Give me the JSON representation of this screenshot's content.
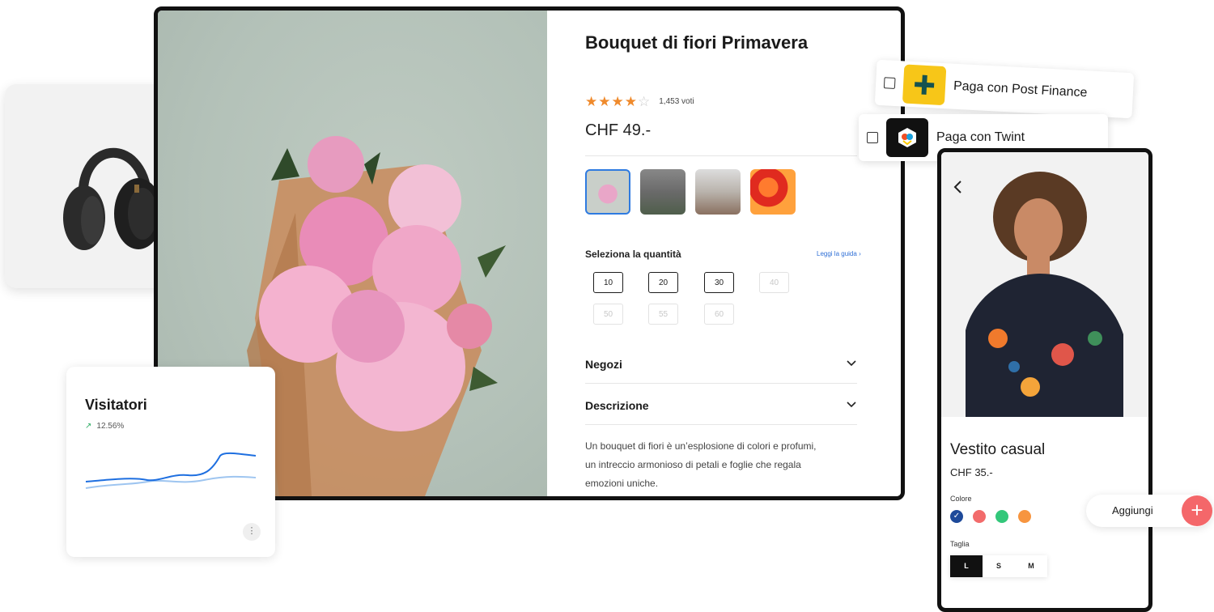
{
  "product": {
    "title": "Bouquet di fiori Primavera",
    "rating": 4,
    "rating_max": 5,
    "votes": "1,453 voti",
    "price": "CHF 49.-",
    "thumbnails": [
      "bouquet-peonies",
      "tulips-vase",
      "dried-flowers",
      "orange-red-roses"
    ],
    "quantity_label": "Seleziona la quantità",
    "guide_link": "Leggi la guida",
    "quantities": [
      {
        "value": "10",
        "enabled": true
      },
      {
        "value": "20",
        "enabled": true
      },
      {
        "value": "30",
        "enabled": true
      },
      {
        "value": "40",
        "enabled": false
      },
      {
        "value": "50",
        "enabled": false
      },
      {
        "value": "55",
        "enabled": false
      },
      {
        "value": "60",
        "enabled": false
      }
    ],
    "accordion": [
      "Negozi",
      "Descrizione"
    ],
    "description": "Un bouquet di fiori è un’esplosione di colori e profumi, un intreccio armonioso di petali e foglie che regala emozioni uniche."
  },
  "visitors": {
    "title": "Visitatori",
    "growth": "12.56%",
    "menu_icon": "more-vertical-icon"
  },
  "payments": [
    {
      "label": "Paga con Post Finance",
      "checked": false,
      "icon": "postfinance-logo"
    },
    {
      "label": "Paga con Twint",
      "checked": false,
      "icon": "twint-logo"
    }
  ],
  "phone": {
    "name": "Vestito casual",
    "price": "CHF 35.-",
    "color_label": "Colore",
    "colors": [
      "#1e4a9a",
      "#f26b6b",
      "#33c77a",
      "#f7953f"
    ],
    "selected_color": 0,
    "size_label": "Taglia",
    "sizes": [
      "L",
      "S",
      "M"
    ],
    "selected_size": "L",
    "add_label": "Aggiungi"
  },
  "colors": {
    "accent": "#2f7be0",
    "star": "#ef8a2c",
    "add": "#f4676a"
  }
}
